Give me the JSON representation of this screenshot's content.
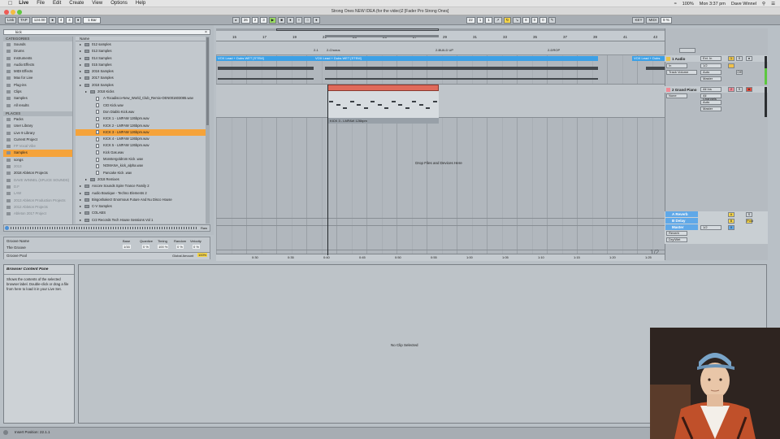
{
  "menubar": {
    "items": [
      "Live",
      "File",
      "Edit",
      "Create",
      "View",
      "Options",
      "Help"
    ],
    "right": [
      "100%",
      "Mon 3:37 pm",
      "Dave Winnel"
    ]
  },
  "window": {
    "title": "Strong Ones NEW IDEA (for the video)2  [Fader Pro Strong Ones]"
  },
  "transport": {
    "link": "Link",
    "tap": "TAP",
    "tempo": "124.00",
    "sig_num": "4",
    "sig_den": "4",
    "quant": "1 Bar",
    "pos": [
      "26",
      "2",
      "3"
    ],
    "loop_start": [
      "22",
      "1",
      "1"
    ],
    "loop_len": [
      "8",
      "0",
      "0"
    ],
    "key": "KEY",
    "midi": "MIDI",
    "cpu": "9 %"
  },
  "browser": {
    "search": "kick",
    "categories_label": "CATEGORIES",
    "categories": [
      "Sounds",
      "Drums",
      "Instruments",
      "Audio Effects",
      "MIDI Effects",
      "Max for Live",
      "Plug-ins",
      "Clips",
      "Samples",
      "All results"
    ],
    "places_label": "PLACES",
    "places": [
      {
        "label": "Packs",
        "dim": false,
        "sel": false
      },
      {
        "label": "User Library",
        "dim": false,
        "sel": false
      },
      {
        "label": "Live 9 Library",
        "dim": false,
        "sel": false
      },
      {
        "label": "Current Project",
        "dim": false,
        "sel": false
      },
      {
        "label": "FP Vocal Vibe",
        "dim": true,
        "sel": false
      },
      {
        "label": "Samples",
        "dim": false,
        "sel": true
      },
      {
        "label": "songs",
        "dim": false,
        "sel": false
      },
      {
        "label": "2013",
        "dim": true,
        "sel": false
      },
      {
        "label": "2018 Ableton Projects",
        "dim": false,
        "sel": false
      },
      {
        "label": "DAVE WINNEL (SPLICE SOUNDS)",
        "dim": true,
        "sel": false
      },
      {
        "label": "D.F",
        "dim": true,
        "sel": false
      },
      {
        "label": "LAW",
        "dim": true,
        "sel": false
      },
      {
        "label": "2013 Ableton Production Projects",
        "dim": true,
        "sel": false
      },
      {
        "label": "2012 Ableton Projects",
        "dim": true,
        "sel": false
      },
      {
        "label": "Ableton 2017 Project",
        "dim": true,
        "sel": false
      }
    ],
    "name_header": "Name",
    "files": [
      {
        "label": "012 samples",
        "type": "folder",
        "indent": 1,
        "sel": false
      },
      {
        "label": "013 Samples",
        "type": "folder",
        "indent": 1,
        "sel": false
      },
      {
        "label": "014 Samples",
        "type": "folder",
        "indent": 1,
        "sel": false
      },
      {
        "label": "015 Samples",
        "type": "folder",
        "indent": 1,
        "sel": false
      },
      {
        "label": "2016 Samples",
        "type": "folder",
        "indent": 1,
        "sel": false
      },
      {
        "label": "2017 Samples",
        "type": "folder",
        "indent": 1,
        "sel": false
      },
      {
        "label": "2018 Samples",
        "type": "folder",
        "indent": 1,
        "sel": false
      },
      {
        "label": "2018 Kicks",
        "type": "folder",
        "indent": 2,
        "sel": false
      },
      {
        "label": "A-Tocadisco-New_World_Club_Remix-OEN001603085.wav",
        "type": "file",
        "indent": 3,
        "sel": false
      },
      {
        "label": "CID Kick.wav",
        "type": "file",
        "indent": 3,
        "sel": false
      },
      {
        "label": "Don Diablo Kick.wav",
        "type": "file",
        "indent": 3,
        "sel": false
      },
      {
        "label": "KICK 1 - LMFAW 126bpm.wav",
        "type": "file",
        "indent": 3,
        "sel": false
      },
      {
        "label": "KICK 2 - LMFAW 126bpm.wav",
        "type": "file",
        "indent": 3,
        "sel": false
      },
      {
        "label": "KICK 3 - LMFAW 126bpm.wav",
        "type": "file",
        "indent": 3,
        "sel": true
      },
      {
        "label": "KICK 4 - LMFAW 126bpm.wav",
        "type": "file",
        "indent": 3,
        "sel": false
      },
      {
        "label": "KICK 5 - LMFAW 126bpm.wav",
        "type": "file",
        "indent": 3,
        "sel": false
      },
      {
        "label": "Kick Gas.wav",
        "type": "file",
        "indent": 3,
        "sel": false
      },
      {
        "label": "Monstergoldrom Kick .wav",
        "type": "file",
        "indent": 3,
        "sel": false
      },
      {
        "label": "NOMANA_kick_alpha.wav",
        "type": "file",
        "indent": 3,
        "sel": false
      },
      {
        "label": "Pancake Kick .wav",
        "type": "file",
        "indent": 3,
        "sel": false
      },
      {
        "label": "2018 Remixes",
        "type": "folder",
        "indent": 2,
        "sel": false
      },
      {
        "label": "Ancore Sounds Spire Trance Family 2",
        "type": "folder",
        "indent": 1,
        "sel": false
      },
      {
        "label": "Audio Boutique - Techno Elements 2",
        "type": "folder",
        "indent": 1,
        "sel": false
      },
      {
        "label": "Bingoshakerz Enormous Future And Nu Disco House",
        "type": "folder",
        "indent": 1,
        "sel": false
      },
      {
        "label": "C-V Samples",
        "type": "folder",
        "indent": 1,
        "sel": false
      },
      {
        "label": "COLABS",
        "type": "folder",
        "indent": 1,
        "sel": false
      },
      {
        "label": "Cr2 Records Tech House Sessions Vol 1",
        "type": "folder",
        "indent": 1,
        "sel": false
      }
    ],
    "raw": "Raw",
    "groove": {
      "name_label": "Groove Name",
      "name": "The Groove",
      "cols": [
        "Base",
        "Quantize",
        "Timing",
        "Random",
        "Velocity"
      ],
      "vals": [
        "1/16",
        "0 %",
        "100 %",
        "0 %",
        "0 %"
      ],
      "pool": "Groove Pool",
      "global_amount": "Global Amount",
      "global_val": "100%"
    }
  },
  "arrangement": {
    "ruler_bars": [
      "15",
      "17",
      "19",
      "21",
      "23",
      "25",
      "27",
      "29",
      "31",
      "33",
      "35",
      "37",
      "39",
      "41",
      "43"
    ],
    "time_ticks": [
      "0:30",
      "0:35",
      "0:40",
      "0:45",
      "0:50",
      "0:55",
      "1:00",
      "1:05",
      "1:10",
      "1:15",
      "1:20",
      "1:25"
    ],
    "locators": [
      "2-1",
      "2-Chorus",
      "2-BUILD UP",
      "2-DROP"
    ],
    "clip1": "VOX Lead + Dubs WET [STEM]",
    "clip2": "VOX Lead + Dubs WET [STEM]",
    "clip3": "VOX Lead + Dubs",
    "midi_clip": "KICK 3 - LMFAW 126bpm",
    "drop_text": "Drop Files and Devices Here",
    "page": "1/2"
  },
  "mixer": {
    "tracks": [
      {
        "name": "1 Audio",
        "in": "Ext. In",
        "sub": "Master",
        "color": "#e7c24a",
        "num": "1"
      },
      {
        "name": "2 Grand Piano",
        "in": "All Ins",
        "sub": "All Channels",
        "color": "#f08a96",
        "num": "2"
      }
    ],
    "returns": [
      {
        "name": "A Reverb",
        "color": "#5fa8e8",
        "btn": "A"
      },
      {
        "name": "B Delay",
        "color": "#5fa8e8",
        "btn": "B"
      },
      {
        "name": "Master",
        "color": "#5fa8e8",
        "btn": "0"
      }
    ],
    "audio_from": "Track Volume",
    "auto": "Auto",
    "off": "Off",
    "in": "In",
    "none": "None",
    "reverb": "Reverb",
    "dry_wet": "Dry/Wet",
    "in_1_2": "1/2",
    "s": "S",
    "post": "Post"
  },
  "info": {
    "title": "Browser Content Pane",
    "body": "Shows the contents of the selected browser label. Double-click or drag a file from here to load it in your Live Set."
  },
  "clipview": {
    "empty": "No Clip Selected"
  },
  "status": {
    "text": "Insert Position: 22.1.1"
  }
}
